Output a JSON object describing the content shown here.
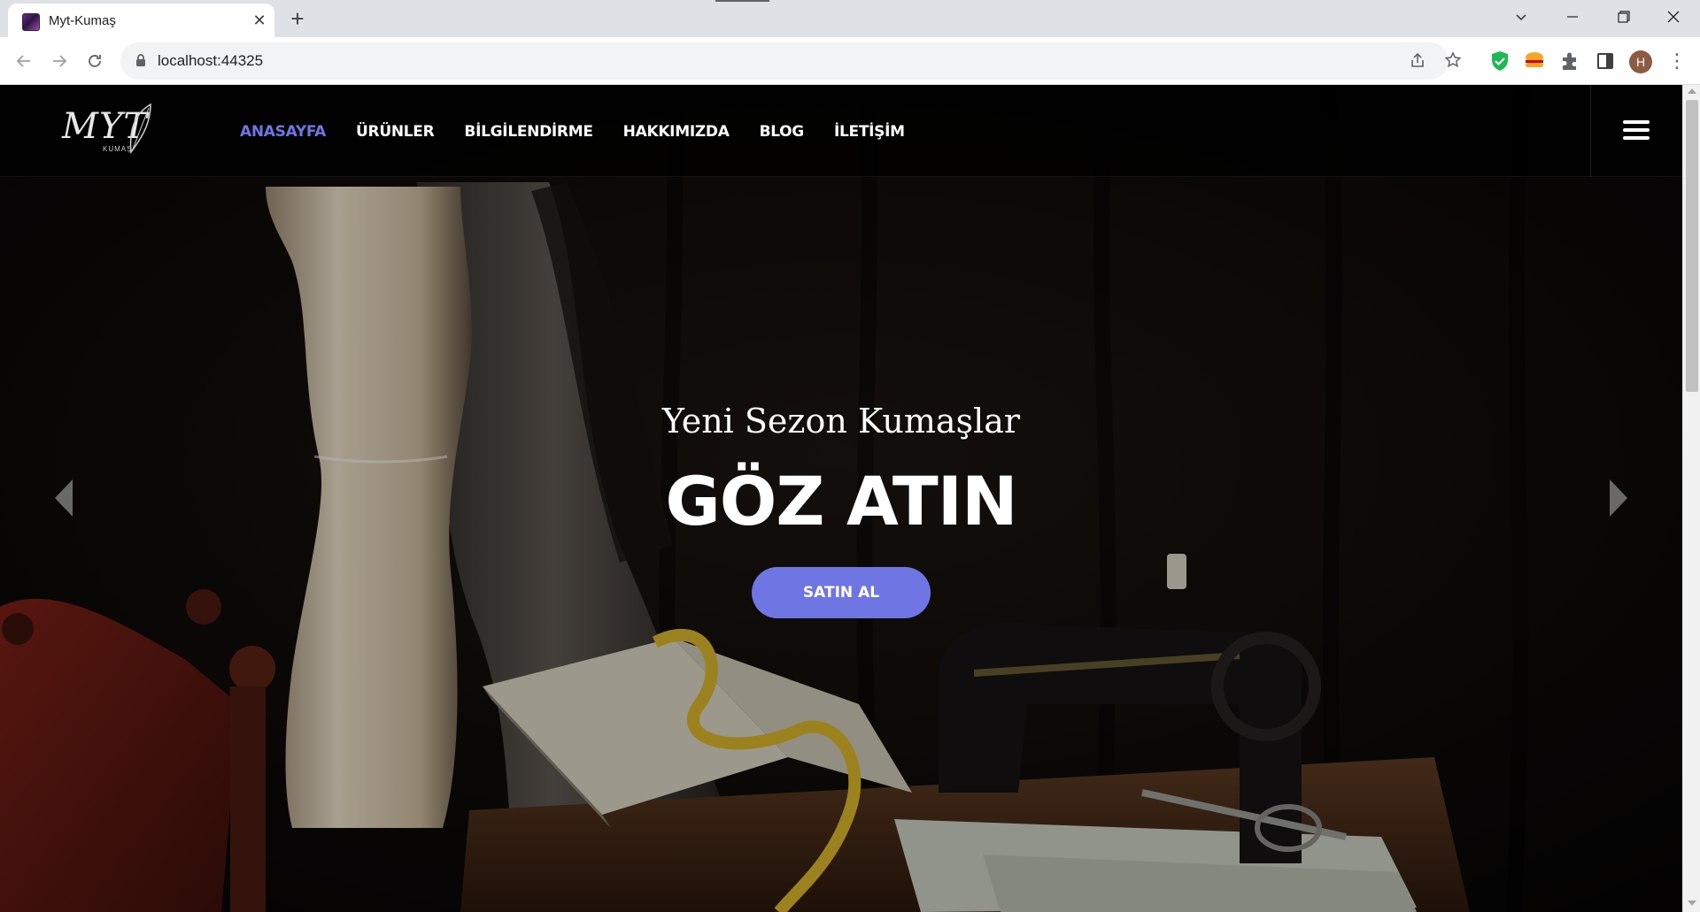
{
  "browser": {
    "tab_title": "Myt-Kumaş",
    "tab_close_icon": "close-icon",
    "new_tab_icon": "plus-icon",
    "url": "localhost:44325",
    "profile_initial": "H",
    "window_controls": [
      "chevron-down-icon",
      "minimize-icon",
      "restore-icon",
      "close-icon"
    ]
  },
  "site": {
    "logo_text": "MYT",
    "logo_sub": "KUMAŞ",
    "nav": [
      {
        "label": "ANASAYFA",
        "active": true
      },
      {
        "label": "ÜRÜNLER"
      },
      {
        "label": "BİLGİLENDİRME"
      },
      {
        "label": "HAKKIMIZDA"
      },
      {
        "label": "BLOG"
      },
      {
        "label": "İLETİŞİM"
      }
    ],
    "accent_color": "#6f76e4"
  },
  "hero": {
    "subtitle": "Yeni Sezon Kumaşlar",
    "title": "GÖZ ATIN",
    "button_label": "SATIN AL"
  }
}
